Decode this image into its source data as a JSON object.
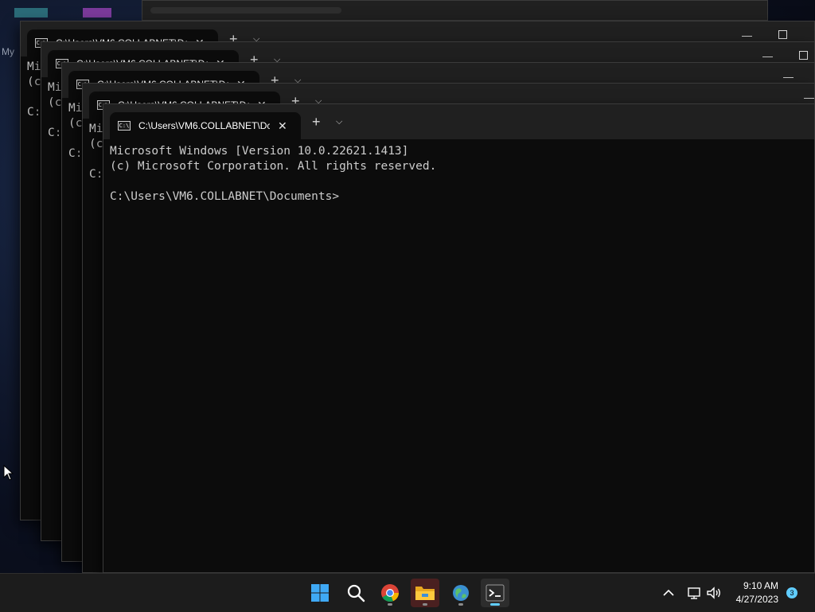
{
  "desktop": {
    "label": "My"
  },
  "terminal": {
    "tab_title": "C:\\Users\\VM6.COLLABNET\\Dc",
    "tab_close": "✕",
    "new_tab": "+",
    "dropdown": "⌵",
    "minimize": "—",
    "bg_line1": "Mi",
    "bg_line2": "(c",
    "bg_line3": "C:",
    "line1": "Microsoft Windows [Version 10.0.22621.1413]",
    "line2": "(c) Microsoft Corporation. All rights reserved.",
    "line3": "",
    "line4": "C:\\Users\\VM6.COLLABNET\\Documents>",
    "icon_text": "C:\\"
  },
  "taskbar": {
    "apps": [
      "start-icon",
      "search-icon",
      "chrome-icon",
      "file-explorer-icon",
      "network-globe-icon",
      "terminal-icon"
    ],
    "tray": {
      "time": "9:10 AM",
      "date": "4/27/2023",
      "notifications": "3"
    }
  },
  "colors": {
    "terminal_bg": "#0c0c0c",
    "tabstrip_bg": "#202020",
    "accent": "#60cdff",
    "text": "#cccccc"
  }
}
